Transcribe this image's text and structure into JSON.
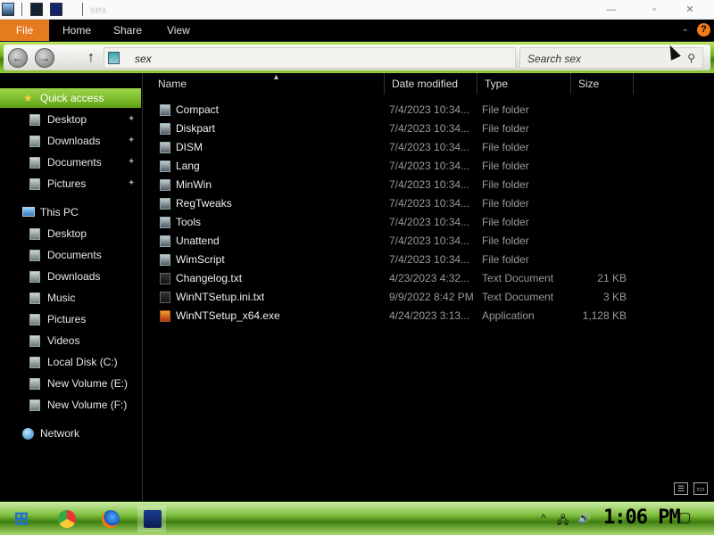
{
  "window": {
    "title": "sex",
    "min_glyph": "—",
    "max_glyph": "▫",
    "close_glyph": "✕"
  },
  "ribbon": {
    "tabs": [
      "File",
      "Home",
      "Share",
      "View"
    ],
    "collapse_glyph": "⌄",
    "help_glyph": "?"
  },
  "addressbar": {
    "back_glyph": "←",
    "forward_glyph": "→",
    "up_glyph": "↑",
    "path": "sex",
    "search_placeholder": "Search sex",
    "search_glyph": "⚲"
  },
  "nav": {
    "quick_access": "Quick access",
    "quick_items": [
      "Desktop",
      "Downloads",
      "Documents",
      "Pictures"
    ],
    "pin_glyph": "✦",
    "star_glyph": "★",
    "this_pc": "This PC",
    "pc_items": [
      "Desktop",
      "Documents",
      "Downloads",
      "Music",
      "Pictures",
      "Videos",
      "Local Disk (C:)",
      "New Volume (E:)",
      "New Volume (F:)"
    ],
    "network": "Network"
  },
  "columns": {
    "name": "Name",
    "date": "Date modified",
    "type": "Type",
    "size": "Size",
    "sort_glyph": "▲"
  },
  "files": [
    {
      "name": "Compact",
      "date": "7/4/2023 10:34...",
      "type": "File folder",
      "size": "",
      "kind": "folder"
    },
    {
      "name": "Diskpart",
      "date": "7/4/2023 10:34...",
      "type": "File folder",
      "size": "",
      "kind": "folder"
    },
    {
      "name": "DISM",
      "date": "7/4/2023 10:34...",
      "type": "File folder",
      "size": "",
      "kind": "folder"
    },
    {
      "name": "Lang",
      "date": "7/4/2023 10:34...",
      "type": "File folder",
      "size": "",
      "kind": "folder"
    },
    {
      "name": "MinWin",
      "date": "7/4/2023 10:34...",
      "type": "File folder",
      "size": "",
      "kind": "folder"
    },
    {
      "name": "RegTweaks",
      "date": "7/4/2023 10:34...",
      "type": "File folder",
      "size": "",
      "kind": "folder"
    },
    {
      "name": "Tools",
      "date": "7/4/2023 10:34...",
      "type": "File folder",
      "size": "",
      "kind": "folder"
    },
    {
      "name": "Unattend",
      "date": "7/4/2023 10:34...",
      "type": "File folder",
      "size": "",
      "kind": "folder"
    },
    {
      "name": "WimScript",
      "date": "7/4/2023 10:34...",
      "type": "File folder",
      "size": "",
      "kind": "folder"
    },
    {
      "name": "Changelog.txt",
      "date": "4/23/2023 4:32...",
      "type": "Text Document",
      "size": "21 KB",
      "kind": "doc"
    },
    {
      "name": "WinNTSetup.ini.txt",
      "date": "9/9/2022 8:42 PM",
      "type": "Text Document",
      "size": "3 KB",
      "kind": "doc"
    },
    {
      "name": "WinNTSetup_x64.exe",
      "date": "4/24/2023 3:13...",
      "type": "Application",
      "size": "1,128 KB",
      "kind": "app"
    }
  ],
  "view": {
    "details_glyph": "☰",
    "tiles_glyph": "▭"
  },
  "taskbar": {
    "start_glyph": "⊞",
    "tray_caret": "^",
    "network_glyph": "🖧",
    "volume_glyph": "🔊",
    "clock": "1:06 PM",
    "notify_glyph": "▢"
  },
  "colors": {
    "accent_green": "#6dad1c",
    "file_tab": "#e57a1f"
  }
}
